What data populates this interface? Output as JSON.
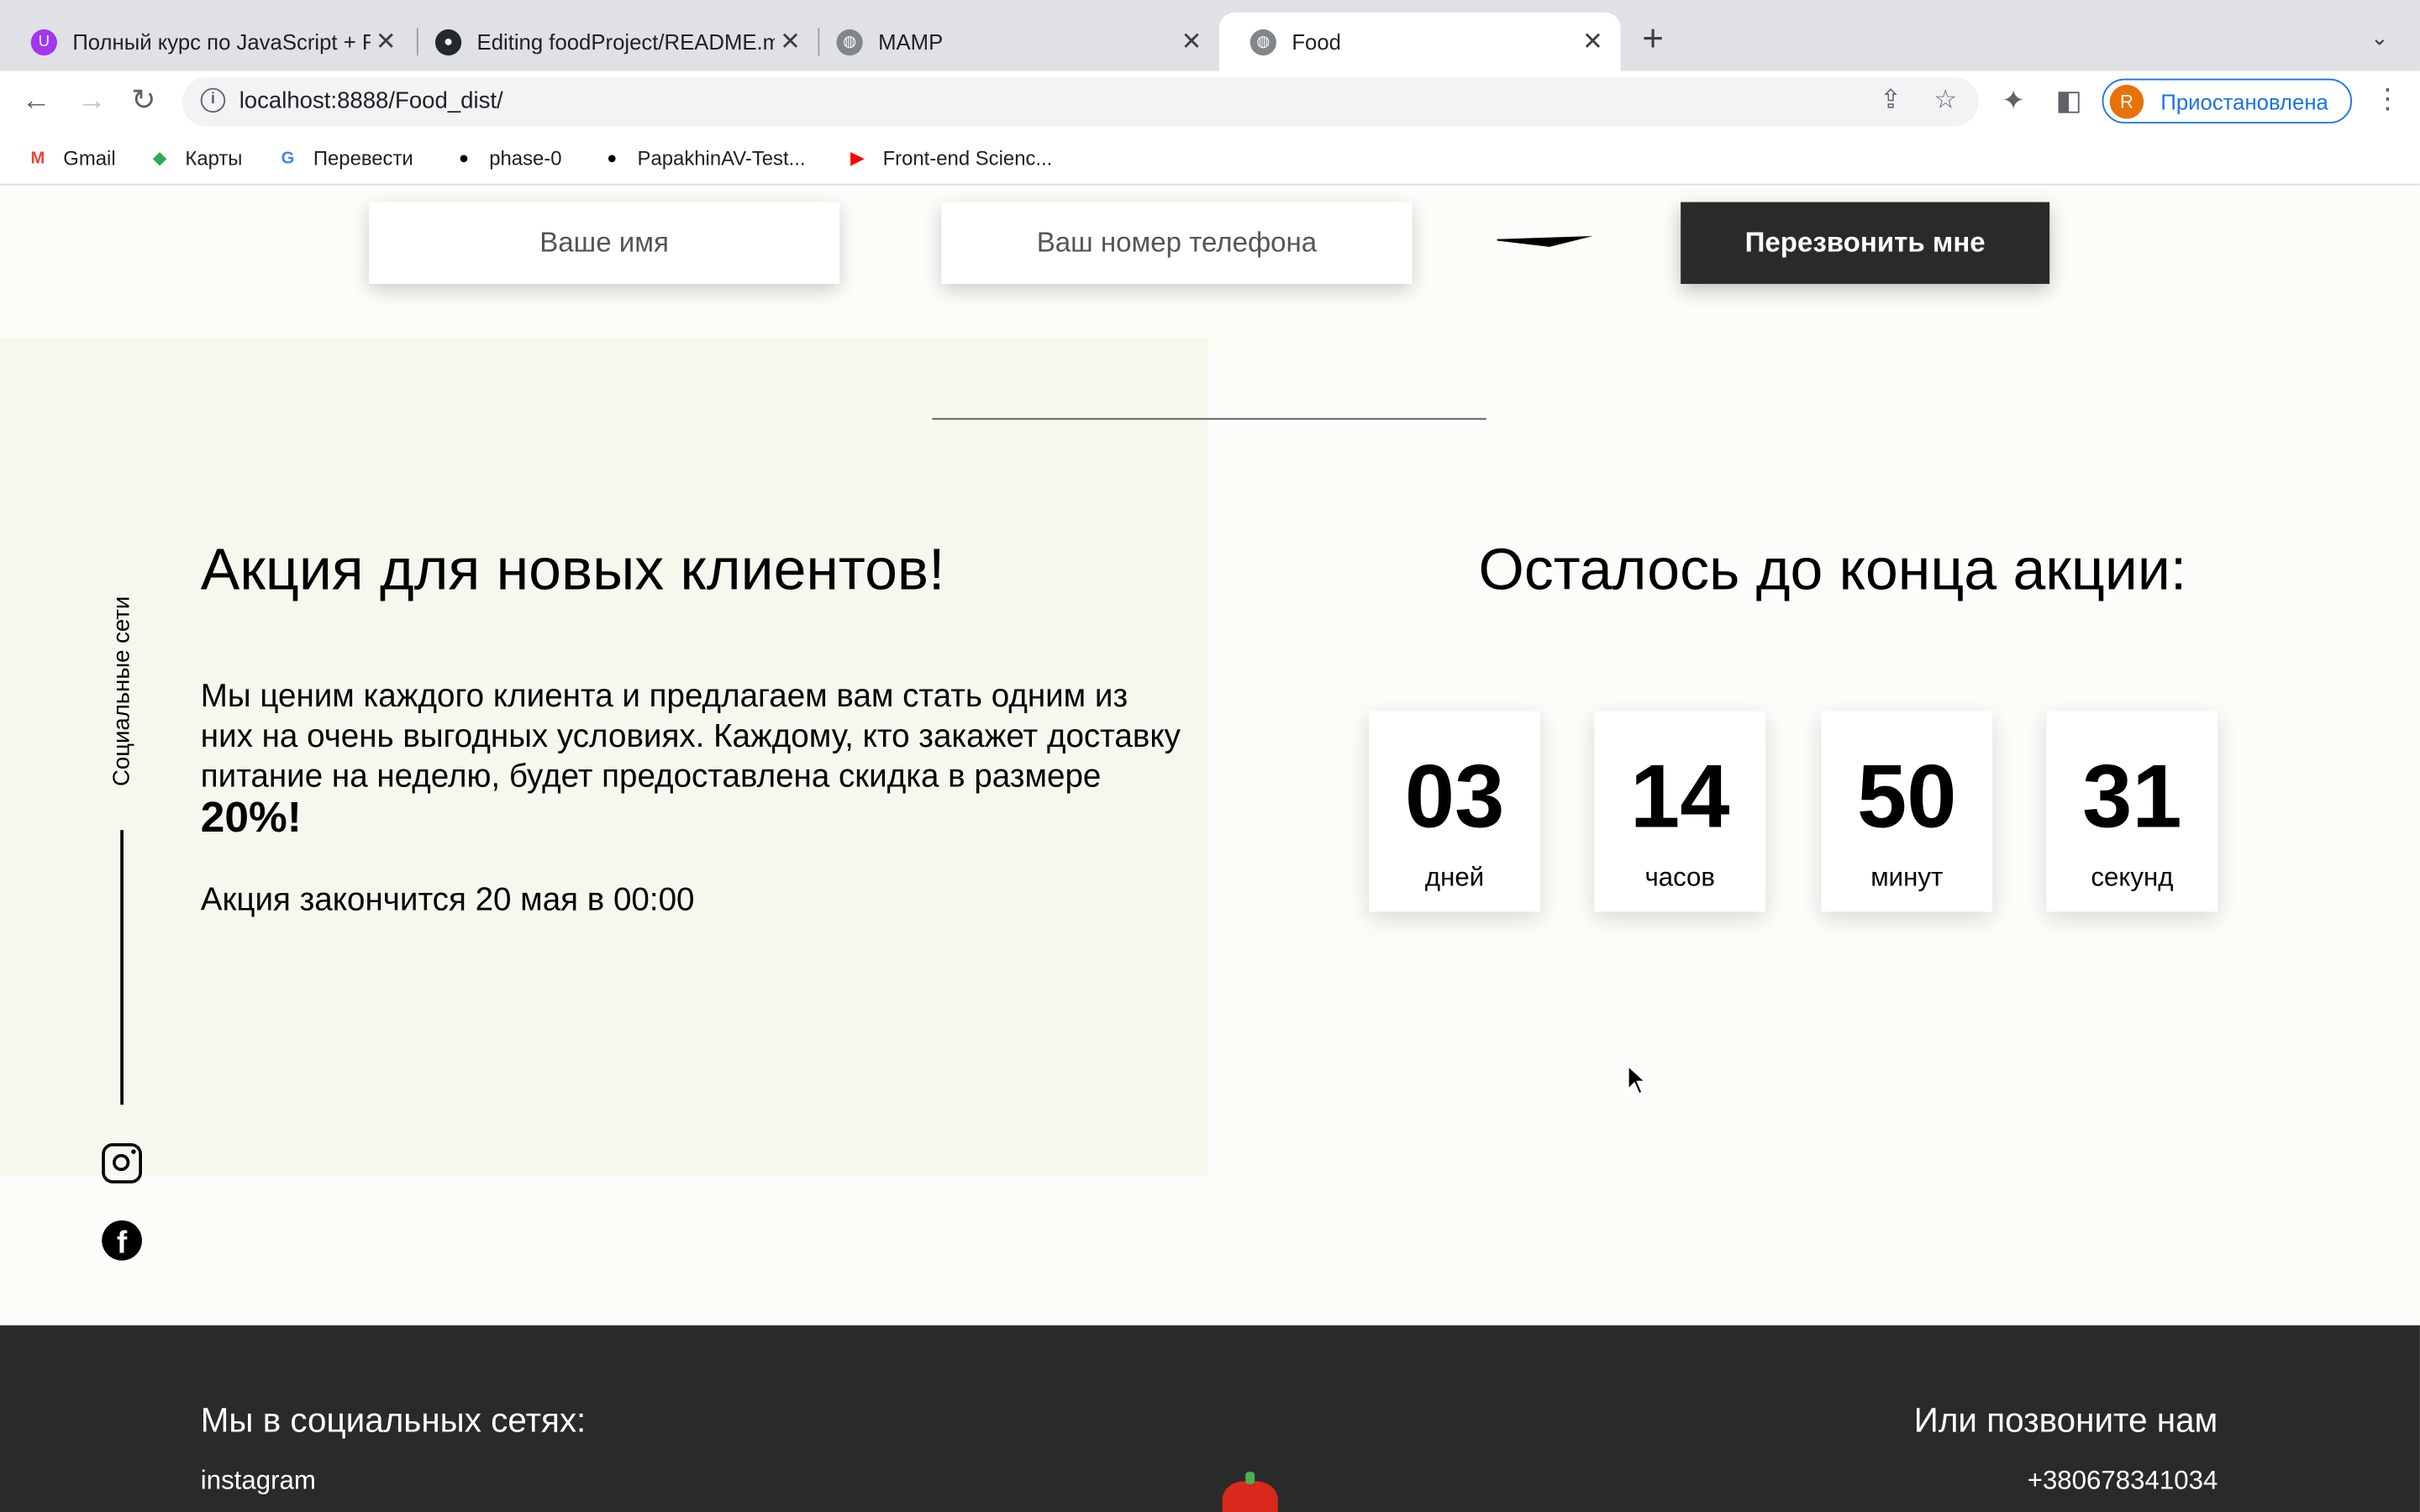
{
  "browser": {
    "tabs": [
      {
        "title": "Полный курс по JavaScript + R",
        "icon": "udemy-icon",
        "active": false
      },
      {
        "title": "Editing foodProject/README.md",
        "icon": "github-icon",
        "active": false
      },
      {
        "title": "MAMP",
        "icon": "globe-icon",
        "active": false
      },
      {
        "title": "Food",
        "icon": "globe-icon",
        "active": true
      }
    ],
    "url": "localhost:8888/Food_dist/",
    "profile_initial": "R",
    "profile_label": "Приостановлена",
    "bookmarks": [
      {
        "label": "Gmail",
        "icon": "gmail-icon"
      },
      {
        "label": "Карты",
        "icon": "maps-icon"
      },
      {
        "label": "Перевести",
        "icon": "translate-icon"
      },
      {
        "label": "phase-0",
        "icon": "github-icon"
      },
      {
        "label": "PapakhinAV-Test...",
        "icon": "github-icon"
      },
      {
        "label": "Front-end Scienc...",
        "icon": "youtube-icon"
      }
    ]
  },
  "order_form": {
    "name_placeholder": "Ваше имя",
    "phone_placeholder": "Ваш номер телефона",
    "submit_label": "Перезвонить мне"
  },
  "social": {
    "label": "Социальные сети",
    "icons": [
      "instagram-icon",
      "facebook-icon"
    ]
  },
  "promotion": {
    "title": "Акция для новых клиентов!",
    "description": "Мы ценим каждого клиента и предлагаем вам стать одним из них на очень выгодных условиях. Каждому, кто закажет доставку питание на неделю, будет предоставлена скидка в размере",
    "discount": "20%!",
    "end_text": "Акция закончится 20 мая в 00:00"
  },
  "timer": {
    "title": "Осталось до конца акции:",
    "units": [
      {
        "value": "03",
        "label": "дней"
      },
      {
        "value": "14",
        "label": "часов"
      },
      {
        "value": "50",
        "label": "минут"
      },
      {
        "value": "31",
        "label": "секунд"
      }
    ]
  },
  "footer": {
    "social_heading": "Мы в социальных сетях:",
    "social_link": "instagram",
    "call_heading": "Или позвоните нам",
    "phone": "+380678341034"
  },
  "colors": {
    "dark": "#2a2a2a",
    "promo_bg": "#f5f8ec",
    "page_bg": "#fcfcf8",
    "accent_blue": "#1a73e8"
  }
}
